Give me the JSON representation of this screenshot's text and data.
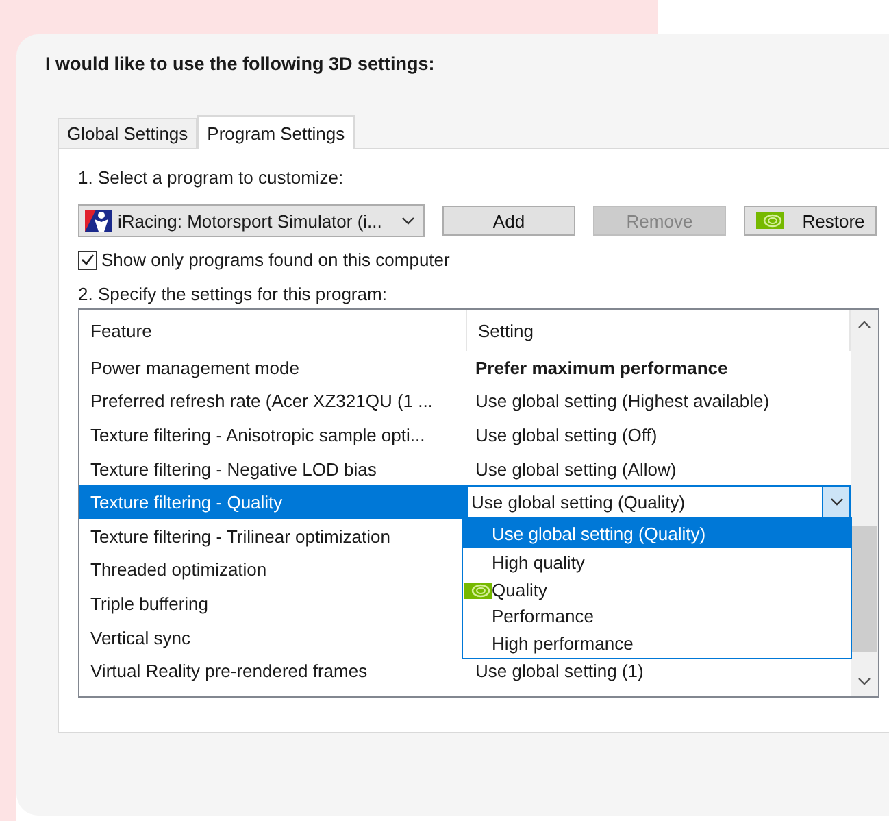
{
  "heading": "I would like to use the following 3D settings:",
  "tabs": [
    {
      "label": "Global Settings",
      "selected": false
    },
    {
      "label": "Program Settings",
      "selected": true
    }
  ],
  "program_section": {
    "label": "1. Select a program to customize:",
    "program": "iRacing: Motorsport Simulator (i...",
    "buttons": [
      {
        "label": "Add",
        "disabled": false,
        "kind": "plain"
      },
      {
        "label": "Remove",
        "disabled": true,
        "kind": "plain"
      },
      {
        "label": "Restore",
        "disabled": false,
        "kind": "logo"
      }
    ]
  },
  "show_only_found": {
    "label": "Show only programs found on this computer",
    "checked": true
  },
  "settings_section": {
    "label": "2. Specify the settings for this program:",
    "columns": [
      "Feature",
      "Setting"
    ],
    "rows": [
      {
        "feature": "Power management mode",
        "setting": "Prefer maximum performance",
        "modified": true,
        "selected": false
      },
      {
        "feature": "Preferred refresh rate (Acer XZ321QU (1 ...",
        "setting": "Use global setting (Highest available)",
        "modified": false,
        "selected": false
      },
      {
        "feature": "Texture filtering - Anisotropic sample opti...",
        "setting": "Use global setting (Off)",
        "modified": false,
        "selected": false
      },
      {
        "feature": "Texture filtering - Negative LOD bias",
        "setting": "Use global setting (Allow)",
        "modified": false,
        "selected": false
      },
      {
        "feature": "Texture filtering - Quality",
        "setting": "Use global setting (Quality)",
        "selected": true
      },
      {
        "feature": "Texture filtering - Trilinear optimization",
        "selected": false
      },
      {
        "feature": "Threaded optimization",
        "selected": false
      },
      {
        "feature": "Triple buffering",
        "selected": false
      },
      {
        "feature": "Vertical sync",
        "selected": false
      },
      {
        "feature": "Virtual Reality pre-rendered frames",
        "setting": "Use global setting (1)",
        "modified": false,
        "selected": false
      }
    ],
    "dropdown": {
      "expanded": true,
      "options": [
        {
          "label": "Use global setting (Quality)",
          "selected": true,
          "recommended": false
        },
        {
          "label": "High quality",
          "selected": false,
          "recommended": false
        },
        {
          "label": "Quality",
          "selected": false,
          "recommended": true
        },
        {
          "label": "Performance",
          "selected": false,
          "recommended": false
        },
        {
          "label": "High performance",
          "selected": false,
          "recommended": false
        }
      ]
    }
  }
}
